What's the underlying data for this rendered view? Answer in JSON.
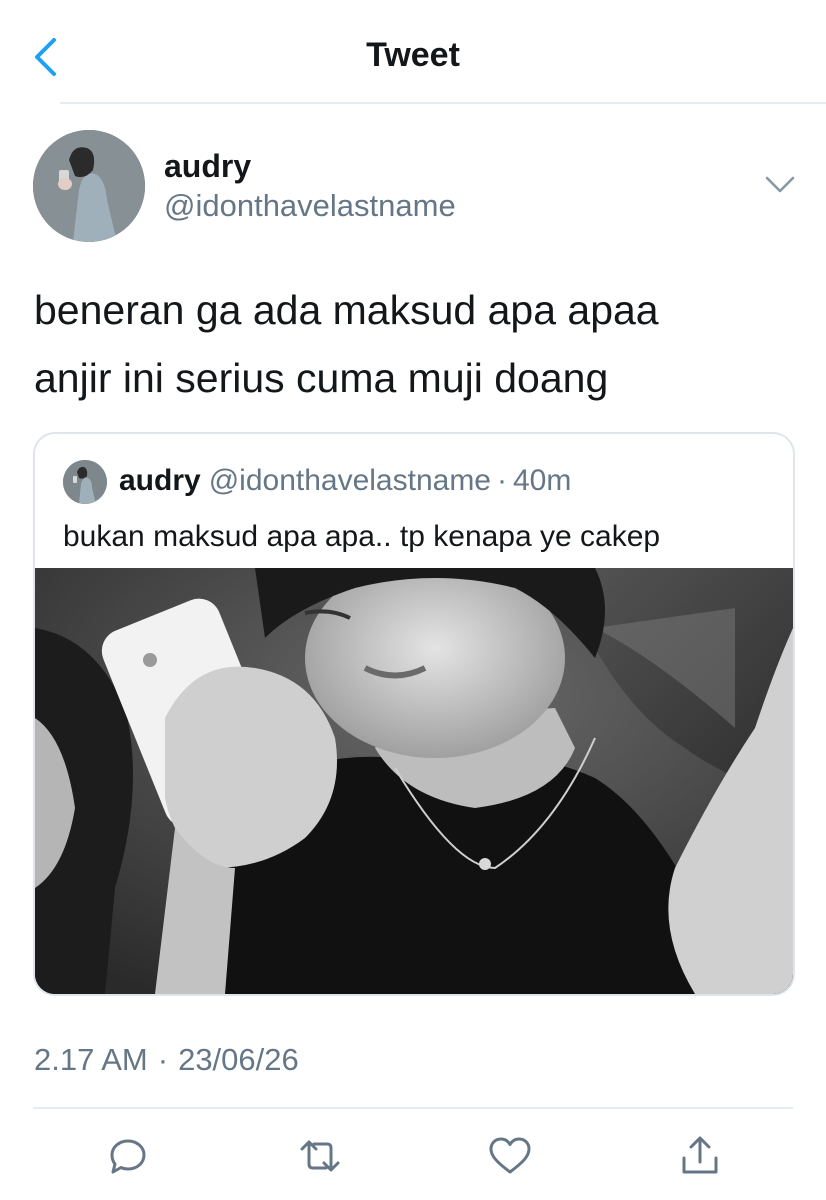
{
  "header": {
    "title": "Tweet",
    "back_icon": "chevron-left-icon"
  },
  "author": {
    "name": "audry",
    "handle": "@idonthavelastname"
  },
  "tweet": {
    "text_lines": [
      "beneran ga ada maksud apa apaa",
      "anjir ini serius cuma muji doang"
    ]
  },
  "quoted_tweet": {
    "name": "audry",
    "handle": "@idonthavelastname",
    "separator": "·",
    "time": "40m",
    "text": "bukan maksud apa apa.. tp kenapa ye cakep"
  },
  "meta": {
    "time": "2.17 AM",
    "separator": "·",
    "date": "23/06/26"
  },
  "actions": [
    "reply-icon",
    "retweet-icon",
    "like-icon",
    "share-icon"
  ],
  "colors": {
    "accent": "#1da1f2",
    "text_primary": "#14171a",
    "text_secondary": "#657786",
    "divider": "#e6ecf0"
  }
}
